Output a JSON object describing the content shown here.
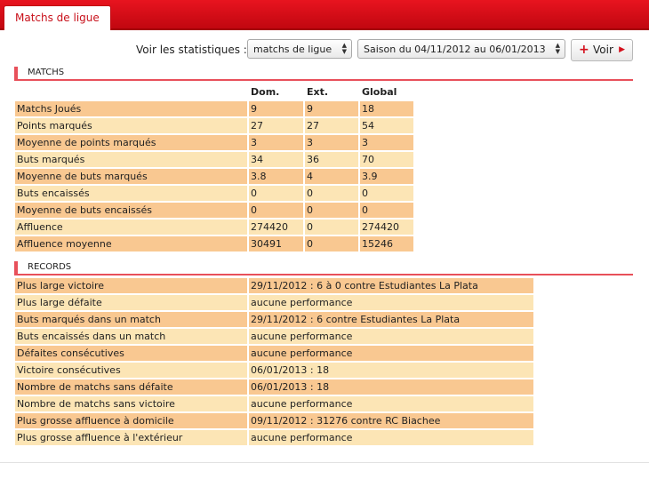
{
  "tab": {
    "label": "Matchs de ligue"
  },
  "controls": {
    "label": "Voir les statistiques :",
    "competition_select": "matchs de ligue",
    "season_select": "Saison du 04/11/2012 au 06/01/2013",
    "voir_button": "Voir"
  },
  "matchs": {
    "title": "MATCHS",
    "headers": [
      "Dom.",
      "Ext.",
      "Global"
    ],
    "rows": [
      {
        "label": "Matchs Joués",
        "dom": "9",
        "ext": "9",
        "global": "18"
      },
      {
        "label": "Points marqués",
        "dom": "27",
        "ext": "27",
        "global": "54"
      },
      {
        "label": "Moyenne de points marqués",
        "dom": "3",
        "ext": "3",
        "global": "3"
      },
      {
        "label": "Buts marqués",
        "dom": "34",
        "ext": "36",
        "global": "70"
      },
      {
        "label": "Moyenne de buts marqués",
        "dom": "3.8",
        "ext": "4",
        "global": "3.9"
      },
      {
        "label": "Buts encaissés",
        "dom": "0",
        "ext": "0",
        "global": "0"
      },
      {
        "label": "Moyenne de buts encaissés",
        "dom": "0",
        "ext": "0",
        "global": "0"
      },
      {
        "label": "Affluence",
        "dom": "274420",
        "ext": "0",
        "global": "274420"
      },
      {
        "label": "Affluence moyenne",
        "dom": "30491",
        "ext": "0",
        "global": "15246"
      }
    ]
  },
  "records": {
    "title": "RECORDS",
    "rows": [
      {
        "label": "Plus large victoire",
        "value": "29/11/2012 : 6 à 0 contre Estudiantes La Plata"
      },
      {
        "label": "Plus large défaite",
        "value": "aucune performance"
      },
      {
        "label": "Buts marqués dans un match",
        "value": "29/11/2012 : 6 contre Estudiantes La Plata"
      },
      {
        "label": "Buts encaissés dans un match",
        "value": "aucune performance"
      },
      {
        "label": "Défaites consécutives",
        "value": "aucune performance"
      },
      {
        "label": "Victoire consécutives",
        "value": "06/01/2013 : 18"
      },
      {
        "label": "Nombre de matchs sans défaite",
        "value": "06/01/2013 : 18"
      },
      {
        "label": "Nombre de matchs sans victoire",
        "value": "aucune performance"
      },
      {
        "label": "Plus grosse affluence à domicile",
        "value": "09/11/2012 : 31276 contre RC Biachee"
      },
      {
        "label": "Plus grosse affluence à l'extérieur",
        "value": "aucune performance"
      }
    ]
  },
  "colors": {
    "accent": "#d4101c",
    "row_dark": "#f9c891",
    "row_light": "#fce5b5"
  }
}
